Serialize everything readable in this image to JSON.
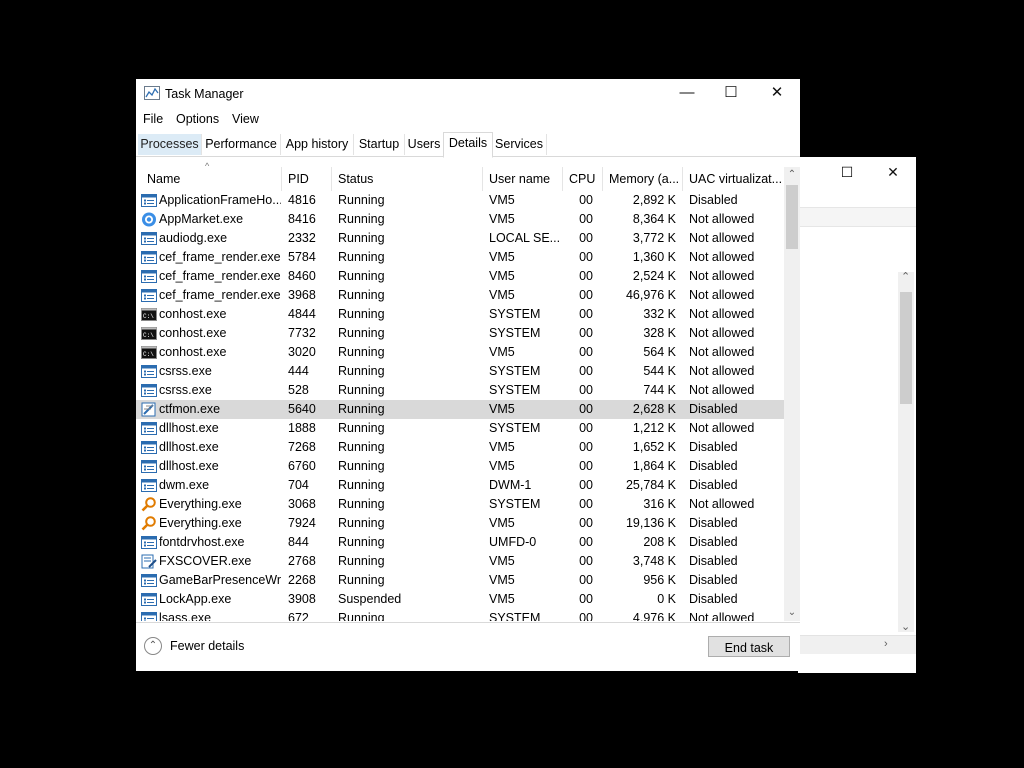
{
  "window": {
    "title": "Task Manager"
  },
  "menu": [
    "File",
    "Options",
    "View"
  ],
  "tabs": [
    "Processes",
    "Performance",
    "App history",
    "Startup",
    "Users",
    "Details",
    "Services"
  ],
  "active_tab": "Details",
  "columns": [
    "Name",
    "PID",
    "Status",
    "User name",
    "CPU",
    "Memory (a...",
    "UAC virtualizat..."
  ],
  "rows": [
    {
      "name": "ApplicationFrameHo...",
      "pid": "4816",
      "status": "Running",
      "user": "VM5",
      "cpu": "00",
      "mem": "2,892 K",
      "uac": "Disabled",
      "icon": "window-icon"
    },
    {
      "name": "AppMarket.exe",
      "pid": "8416",
      "status": "Running",
      "user": "VM5",
      "cpu": "00",
      "mem": "8,364 K",
      "uac": "Not allowed",
      "icon": "globe-icon"
    },
    {
      "name": "audiodg.exe",
      "pid": "2332",
      "status": "Running",
      "user": "LOCAL SE...",
      "cpu": "00",
      "mem": "3,772 K",
      "uac": "Not allowed",
      "icon": "window-icon"
    },
    {
      "name": "cef_frame_render.exe",
      "pid": "5784",
      "status": "Running",
      "user": "VM5",
      "cpu": "00",
      "mem": "1,360 K",
      "uac": "Not allowed",
      "icon": "window-icon"
    },
    {
      "name": "cef_frame_render.exe",
      "pid": "8460",
      "status": "Running",
      "user": "VM5",
      "cpu": "00",
      "mem": "2,524 K",
      "uac": "Not allowed",
      "icon": "window-icon"
    },
    {
      "name": "cef_frame_render.exe",
      "pid": "3968",
      "status": "Running",
      "user": "VM5",
      "cpu": "00",
      "mem": "46,976 K",
      "uac": "Not allowed",
      "icon": "window-icon"
    },
    {
      "name": "conhost.exe",
      "pid": "4844",
      "status": "Running",
      "user": "SYSTEM",
      "cpu": "00",
      "mem": "332 K",
      "uac": "Not allowed",
      "icon": "console-icon"
    },
    {
      "name": "conhost.exe",
      "pid": "7732",
      "status": "Running",
      "user": "SYSTEM",
      "cpu": "00",
      "mem": "328 K",
      "uac": "Not allowed",
      "icon": "console-icon"
    },
    {
      "name": "conhost.exe",
      "pid": "3020",
      "status": "Running",
      "user": "VM5",
      "cpu": "00",
      "mem": "564 K",
      "uac": "Not allowed",
      "icon": "console-icon"
    },
    {
      "name": "csrss.exe",
      "pid": "444",
      "status": "Running",
      "user": "SYSTEM",
      "cpu": "00",
      "mem": "544 K",
      "uac": "Not allowed",
      "icon": "window-icon"
    },
    {
      "name": "csrss.exe",
      "pid": "528",
      "status": "Running",
      "user": "SYSTEM",
      "cpu": "00",
      "mem": "744 K",
      "uac": "Not allowed",
      "icon": "window-icon"
    },
    {
      "name": "ctfmon.exe",
      "pid": "5640",
      "status": "Running",
      "user": "VM5",
      "cpu": "00",
      "mem": "2,628 K",
      "uac": "Disabled",
      "icon": "pen-icon",
      "selected": true
    },
    {
      "name": "dllhost.exe",
      "pid": "1888",
      "status": "Running",
      "user": "SYSTEM",
      "cpu": "00",
      "mem": "1,212 K",
      "uac": "Not allowed",
      "icon": "window-icon"
    },
    {
      "name": "dllhost.exe",
      "pid": "7268",
      "status": "Running",
      "user": "VM5",
      "cpu": "00",
      "mem": "1,652 K",
      "uac": "Disabled",
      "icon": "window-icon"
    },
    {
      "name": "dllhost.exe",
      "pid": "6760",
      "status": "Running",
      "user": "VM5",
      "cpu": "00",
      "mem": "1,864 K",
      "uac": "Disabled",
      "icon": "window-icon"
    },
    {
      "name": "dwm.exe",
      "pid": "704",
      "status": "Running",
      "user": "DWM-1",
      "cpu": "00",
      "mem": "25,784 K",
      "uac": "Disabled",
      "icon": "window-icon"
    },
    {
      "name": "Everything.exe",
      "pid": "3068",
      "status": "Running",
      "user": "SYSTEM",
      "cpu": "00",
      "mem": "316 K",
      "uac": "Not allowed",
      "icon": "magnifier-icon"
    },
    {
      "name": "Everything.exe",
      "pid": "7924",
      "status": "Running",
      "user": "VM5",
      "cpu": "00",
      "mem": "19,136 K",
      "uac": "Disabled",
      "icon": "magnifier-icon"
    },
    {
      "name": "fontdrvhost.exe",
      "pid": "844",
      "status": "Running",
      "user": "UMFD-0",
      "cpu": "00",
      "mem": "208 K",
      "uac": "Disabled",
      "icon": "window-icon"
    },
    {
      "name": "FXSCOVER.exe",
      "pid": "2768",
      "status": "Running",
      "user": "VM5",
      "cpu": "00",
      "mem": "3,748 K",
      "uac": "Disabled",
      "icon": "doc-pen-icon"
    },
    {
      "name": "GameBarPresenceWr...",
      "pid": "2268",
      "status": "Running",
      "user": "VM5",
      "cpu": "00",
      "mem": "956 K",
      "uac": "Disabled",
      "icon": "window-icon"
    },
    {
      "name": "LockApp.exe",
      "pid": "3908",
      "status": "Suspended",
      "user": "VM5",
      "cpu": "00",
      "mem": "0 K",
      "uac": "Disabled",
      "icon": "window-icon"
    },
    {
      "name": "lsass.exe",
      "pid": "672",
      "status": "Running",
      "user": "SYSTEM",
      "cpu": "00",
      "mem": "4,976 K",
      "uac": "Not allowed",
      "icon": "window-icon"
    }
  ],
  "footer": {
    "fewer_details": "Fewer details",
    "end_task": "End task"
  }
}
